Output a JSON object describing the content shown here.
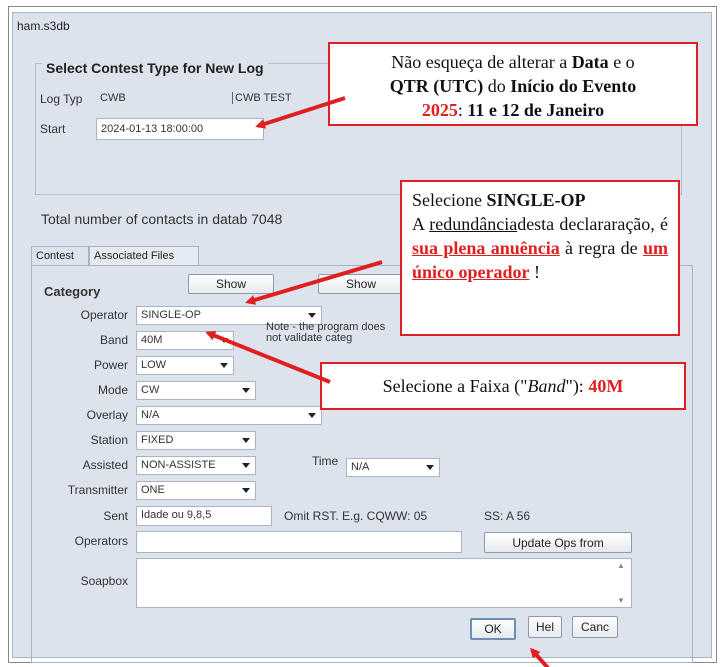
{
  "window": {
    "title": "ham.s3db"
  },
  "contest_group": {
    "title": "Select Contest Type for New Log",
    "log_type_label": "Log Typ",
    "log_type_value": "CWB",
    "log_type_desc": "CWB TEST",
    "start_label": "Start",
    "start_value": "2024-01-13 18:00:00"
  },
  "total_contacts": "Total number of contacts in datab 7048",
  "tabs": [
    {
      "label": "Contest"
    },
    {
      "label": "Associated Files"
    }
  ],
  "form": {
    "category_label": "Category",
    "show1_label": "Show",
    "show2_label": "Show",
    "operator_label": "Operator",
    "operator_value": "SINGLE-OP",
    "band_label": "Band",
    "band_value": "40M",
    "note_text": "Note -  the program does not validate categ",
    "power_label": "Power",
    "power_value": "LOW",
    "mode_label": "Mode",
    "mode_value": "CW",
    "overlay_label": "Overlay",
    "overlay_value": "N/A",
    "station_label": "Station",
    "station_value": "FIXED",
    "assisted_label": "Assisted",
    "assisted_value": "NON-ASSISTE",
    "time_label": "Time",
    "time_value": "N/A",
    "transmitter_label": "Transmitter",
    "transmitter_value": "ONE",
    "sent_label": "Sent",
    "sent_value": "Idade ou 9,8,5",
    "sent_hint": "Omit RST. E.g. CQWW: 05",
    "ss_hint": "SS: A 56",
    "operators_label": "Operators",
    "operators_value": "",
    "update_ops_label": "Update Ops from",
    "soapbox_label": "Soapbox",
    "soapbox_value": "",
    "ok_label": "OK",
    "help_label": "Hel",
    "cancel_label": "Canc"
  },
  "callouts": {
    "c1": {
      "t1": "Não esqueça de alterar a ",
      "t2": "Data",
      "t3": " e o ",
      "t4": "QTR (UTC)",
      "t5": " do ",
      "t6": "Início do Evento",
      "t7": "2025",
      "t8": ": ",
      "t9": "11 e 12 de Janeiro"
    },
    "c2": {
      "t1": "Selecione ",
      "t2": "SINGLE-OP",
      "t3": "A ",
      "t4": "redundância",
      "t5": "desta declararação, é ",
      "t6": "sua plena anuência",
      "t7": " à regra de ",
      "t8": "um único operador",
      "t9": " !"
    },
    "c3": {
      "t1": "Selecione a Faixa (\"",
      "t2": "Band",
      "t3": "\"): ",
      "t4": "40M"
    }
  },
  "colors": {
    "annotation_red": "#e02020",
    "window_bg": "#dce3ed"
  }
}
